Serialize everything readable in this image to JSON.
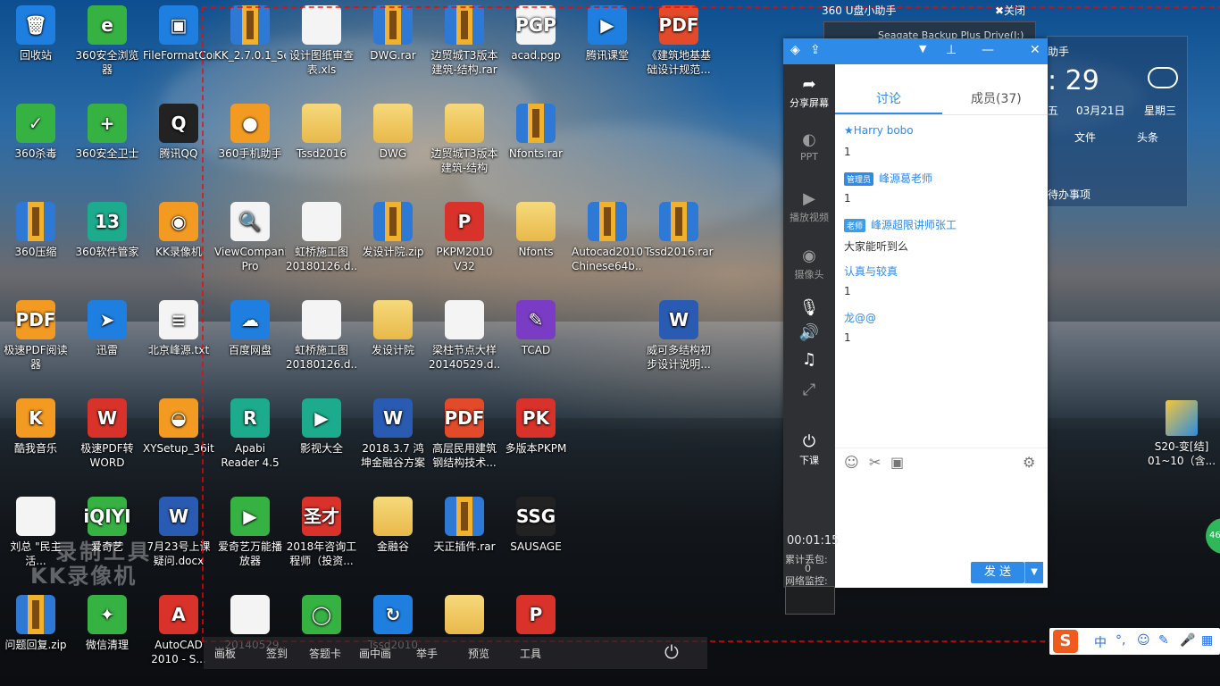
{
  "usb_helper": {
    "title": "360 U盘小助手",
    "close": "✖关闭",
    "device": "Seagate Backup Plus Drive(I:)"
  },
  "widget": {
    "title": "助手",
    "time": ": 29",
    "day": "五",
    "date": "03月21日",
    "weekday": "星期三",
    "file": "文件",
    "headline": "头条",
    "todo": "待办事项"
  },
  "chat": {
    "tabs": {
      "discuss": "讨论",
      "members": "成员(37)"
    },
    "left_buttons": {
      "share": "分享屏幕",
      "ppt": "PPT",
      "video": "播放视频",
      "camera": "摄像头",
      "end_class": "下课"
    },
    "timer": "00:01:15",
    "stats": {
      "packet_loss_label": "累计丢包:",
      "packet_loss_value": "0",
      "net_monitor": "网络监控:"
    },
    "messages": [
      {
        "name": "★Harry bobo",
        "badge": "",
        "body": "1"
      },
      {
        "name": "峰源葛老师",
        "badge": "管理员",
        "body": "1"
      },
      {
        "name": "峰源超限讲师张工",
        "badge": "老师",
        "body": "大家能听到么"
      },
      {
        "name": "认真与较真",
        "badge": "",
        "body": "1"
      },
      {
        "name": "龙@@",
        "badge": "",
        "body": "1"
      }
    ],
    "send": "发 送"
  },
  "bottom_bar": [
    "画板",
    "签到",
    "答题卡",
    "画中画",
    "举手",
    "预览",
    "工具"
  ],
  "watermark": {
    "line1": "录制工具",
    "line2": "KK录像机"
  },
  "desktop": [
    {
      "label": "回收站",
      "glyph": "🗑",
      "cls": "g-blue"
    },
    {
      "label": "360安全浏览器",
      "glyph": "e",
      "cls": "g-green"
    },
    {
      "label": "FileFormatConverters.exe",
      "glyph": "▣",
      "cls": "g-blue"
    },
    {
      "label": "KK_2.7.0.1_Setup.rar",
      "glyph": "",
      "cls": "g-rar"
    },
    {
      "label": "设计图纸审查表.xls",
      "glyph": "",
      "cls": "g-doc"
    },
    {
      "label": "DWG.rar",
      "glyph": "",
      "cls": "g-rar"
    },
    {
      "label": "边贸城T3版本建筑-结构.rar",
      "glyph": "",
      "cls": "g-rar"
    },
    {
      "label": "acad.pgp",
      "glyph": "PGP",
      "cls": "g-doc"
    },
    {
      "label": "腾讯课堂",
      "glyph": "▶",
      "cls": "g-blue"
    },
    {
      "label": "《建筑地基基础设计规范...",
      "glyph": "PDF",
      "cls": "g-pdf"
    },
    {
      "label": "360杀毒",
      "glyph": "✓",
      "cls": "g-green"
    },
    {
      "label": "360安全卫士",
      "glyph": "+",
      "cls": "g-green"
    },
    {
      "label": "腾讯QQ",
      "glyph": "Q",
      "cls": "g-dark"
    },
    {
      "label": "360手机助手",
      "glyph": "●",
      "cls": "g-orange"
    },
    {
      "label": "Tssd2016",
      "glyph": "",
      "cls": "g-folder"
    },
    {
      "label": "DWG",
      "glyph": "",
      "cls": "g-folder"
    },
    {
      "label": "边贸城T3版本建筑-结构",
      "glyph": "",
      "cls": "g-folder"
    },
    {
      "label": "Nfonts.rar",
      "glyph": "",
      "cls": "g-rar"
    },
    {
      "label": "360压缩",
      "glyph": "",
      "cls": "g-rar"
    },
    {
      "label": "360软件管家",
      "glyph": "13",
      "cls": "g-teal"
    },
    {
      "label": "KK录像机",
      "glyph": "◉",
      "cls": "g-orange"
    },
    {
      "label": "ViewCompanion Pro",
      "glyph": "🔍",
      "cls": "g-doc"
    },
    {
      "label": "虹桥施工图20180126.d...",
      "glyph": "",
      "cls": "g-doc"
    },
    {
      "label": "发设计院.zip",
      "glyph": "",
      "cls": "g-rar"
    },
    {
      "label": "PKPM2010 V32",
      "glyph": "P",
      "cls": "g-red"
    },
    {
      "label": "Nfonts",
      "glyph": "",
      "cls": "g-folder"
    },
    {
      "label": "Autocad2010 Chinese64b...",
      "glyph": "",
      "cls": "g-rar"
    },
    {
      "label": "Tssd2016.rar",
      "glyph": "",
      "cls": "g-rar"
    },
    {
      "label": "极速PDF阅读器",
      "glyph": "PDF",
      "cls": "g-orange"
    },
    {
      "label": "迅雷",
      "glyph": "➤",
      "cls": "g-blue"
    },
    {
      "label": "北京峰源.txt",
      "glyph": "≡",
      "cls": "g-doc"
    },
    {
      "label": "百度网盘",
      "glyph": "☁",
      "cls": "g-blue"
    },
    {
      "label": "虹桥施工图20180126.d...",
      "glyph": "",
      "cls": "g-doc"
    },
    {
      "label": "发设计院",
      "glyph": "",
      "cls": "g-folder"
    },
    {
      "label": "梁柱节点大样20140529.d...",
      "glyph": "",
      "cls": "g-doc"
    },
    {
      "label": "TCAD",
      "glyph": "✎",
      "cls": "g-purple"
    },
    {
      "label": "威可多结构初步设计说明...",
      "glyph": "W",
      "cls": "g-word"
    },
    {
      "label": "酷我音乐",
      "glyph": "K",
      "cls": "g-orange"
    },
    {
      "label": "极速PDF转WORD",
      "glyph": "W",
      "cls": "g-red"
    },
    {
      "label": "XYSetup_36itu_3.0.9.100...",
      "glyph": "◒",
      "cls": "g-orange"
    },
    {
      "label": "Apabi Reader 4.5",
      "glyph": "R",
      "cls": "g-teal"
    },
    {
      "label": "影视大全",
      "glyph": "▶",
      "cls": "g-teal"
    },
    {
      "label": "2018.3.7 鸿坤金融谷方案 ...",
      "glyph": "W",
      "cls": "g-word"
    },
    {
      "label": "高层民用建筑钢结构技术...",
      "glyph": "PDF",
      "cls": "g-pdf"
    },
    {
      "label": "多版本PKPM",
      "glyph": "PK",
      "cls": "g-red"
    },
    {
      "label": "刘总 \"民主活...",
      "glyph": "",
      "cls": "g-doc"
    },
    {
      "label": "爱奇艺",
      "glyph": "iQIYI",
      "cls": "g-green"
    },
    {
      "label": "7月23号上课疑问.docx",
      "glyph": "W",
      "cls": "g-word"
    },
    {
      "label": "爱奇艺万能播放器",
      "glyph": "▶",
      "cls": "g-green"
    },
    {
      "label": "2018年咨询工程师（投资...",
      "glyph": "圣才",
      "cls": "g-red"
    },
    {
      "label": "金融谷",
      "glyph": "",
      "cls": "g-folder"
    },
    {
      "label": "天正插件.rar",
      "glyph": "",
      "cls": "g-rar"
    },
    {
      "label": "SAUSAGE",
      "glyph": "SSG",
      "cls": "g-dark"
    },
    {
      "label": "问题回复.zip",
      "glyph": "",
      "cls": "g-rar"
    },
    {
      "label": "微信清理",
      "glyph": "✦",
      "cls": "g-green"
    },
    {
      "label": "AutoCAD 2010 - S...",
      "glyph": "A",
      "cls": "g-red"
    },
    {
      "label": "...20140529...",
      "glyph": "",
      "cls": "g-doc"
    },
    {
      "label": "",
      "glyph": "◯",
      "cls": "g-green"
    },
    {
      "label": "Tssd2010",
      "glyph": "↻",
      "cls": "g-blue"
    },
    {
      "label": "",
      "glyph": "",
      "cls": "g-folder"
    },
    {
      "label": "",
      "glyph": "P",
      "cls": "g-red"
    }
  ],
  "s20": {
    "label": "S20-变[结] 01~10（含..."
  },
  "ime": {
    "logo": "S",
    "mode": "中"
  }
}
